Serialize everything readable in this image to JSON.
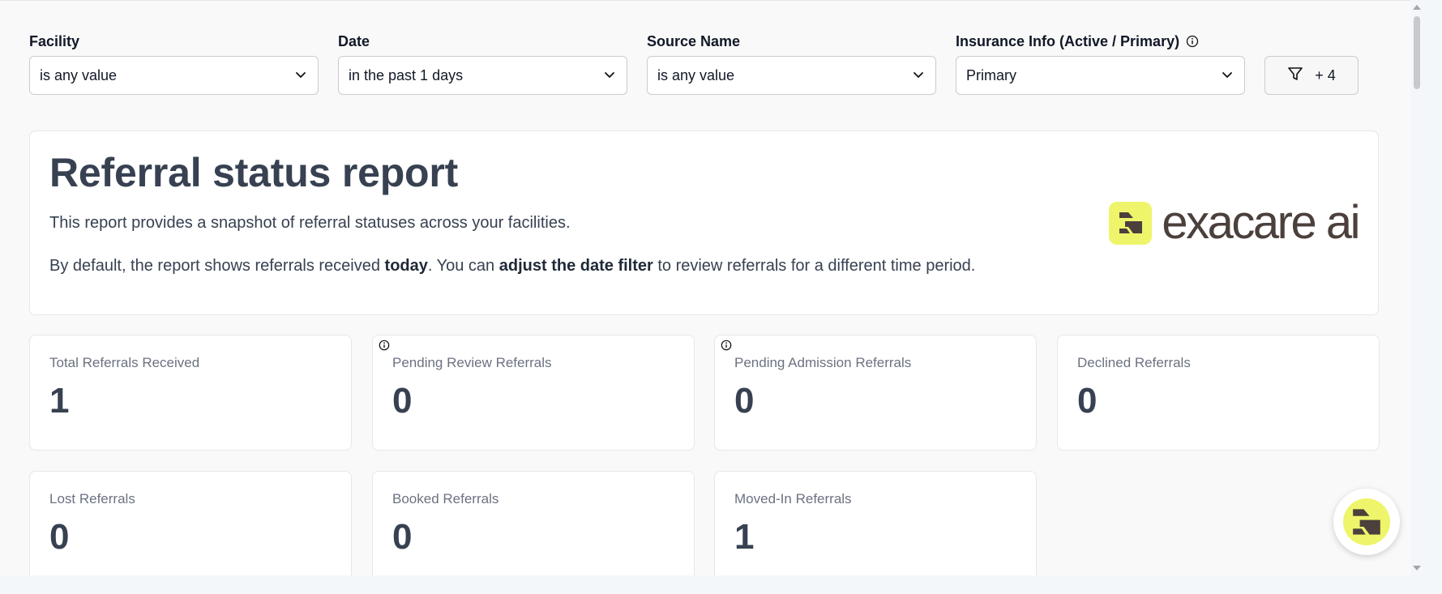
{
  "filters": [
    {
      "label": "Facility",
      "value": "is any value",
      "info": false
    },
    {
      "label": "Date",
      "value": "in the past 1 days",
      "info": false
    },
    {
      "label": "Source Name",
      "value": "is any value",
      "info": false
    },
    {
      "label": "Insurance Info (Active / Primary)",
      "value": "Primary",
      "info": true
    }
  ],
  "more_filters": {
    "label": "+ 4",
    "icon": "filter-icon"
  },
  "report": {
    "title": "Referral status report",
    "description": "This report provides a snapshot of referral statuses across your facilities.",
    "note_part1": "By default, the report shows referrals received ",
    "note_bold1": "today",
    "note_part2": ". You can ",
    "note_bold2": "adjust the date filter",
    "note_part3": " to review referrals for a different time period."
  },
  "logo": {
    "text": "exacare ai",
    "accent": "#eef56a",
    "mark_color": "#4b403c"
  },
  "metrics": [
    {
      "label": "Total Referrals Received",
      "value": "1",
      "info": false
    },
    {
      "label": "Pending Review Referrals",
      "value": "0",
      "info": true
    },
    {
      "label": "Pending Admission Referrals",
      "value": "0",
      "info": true
    },
    {
      "label": "Declined Referrals",
      "value": "0",
      "info": false
    },
    {
      "label": "Lost Referrals",
      "value": "0",
      "info": false
    },
    {
      "label": "Booked Referrals",
      "value": "0",
      "info": false
    },
    {
      "label": "Moved-In Referrals",
      "value": "1",
      "info": false
    }
  ],
  "fab": {
    "icon": "exacare-assistant-icon"
  }
}
